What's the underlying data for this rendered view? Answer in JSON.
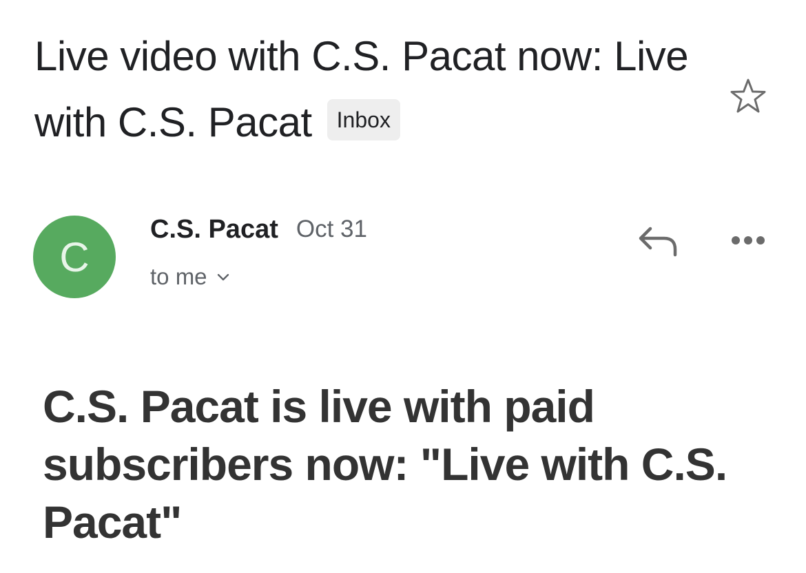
{
  "subject": {
    "title": "Live video with C.S. Pacat now: Live with C.S. Pacat",
    "label": "Inbox"
  },
  "message": {
    "avatar_letter": "C",
    "sender_name": "C.S. Pacat",
    "date": "Oct 31",
    "recipient": "to me"
  },
  "body": {
    "heading": "C.S. Pacat is live with paid subscribers now: \"Live with C.S. Pacat\""
  },
  "colors": {
    "avatar": "#57aa5f",
    "label_bg": "#eeeeee",
    "secondary_text": "#5f6368",
    "heading_text": "#333333"
  },
  "icons": {
    "star": "star-outline-icon",
    "reply": "reply-arrow-icon",
    "more": "three-dots-icon",
    "chevron": "chevron-down-icon"
  }
}
